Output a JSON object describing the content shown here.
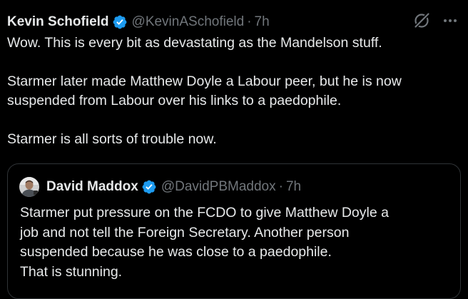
{
  "colors": {
    "background": "#000000",
    "text_primary": "#e7e9ea",
    "text_secondary": "#71767b",
    "verified_badge": "#1d9bf0",
    "border": "#2f3336"
  },
  "tweet": {
    "author_name": "Kevin Schofield",
    "author_handle": "@KevinASchofield",
    "separator": "·",
    "time": "7h",
    "icons": [
      "grok-icon",
      "more-icon"
    ],
    "paragraphs": [
      "Wow. This is every bit as devastating as the Mandelson stuff.",
      "Starmer later made Matthew Doyle a Labour peer, but he is now suspended from Labour over his links to a paedophile.",
      "Starmer is all sorts of trouble now."
    ]
  },
  "quoted_tweet": {
    "author_name": "David Maddox",
    "author_handle": "@DavidPBMaddox",
    "separator": "·",
    "time": "7h",
    "lines": [
      "Starmer put pressure on the FCDO to give Matthew Doyle a",
      "job and not tell the Foreign Secretary. Another person",
      "suspended because he was close to a paedophile.",
      "That is stunning."
    ]
  }
}
